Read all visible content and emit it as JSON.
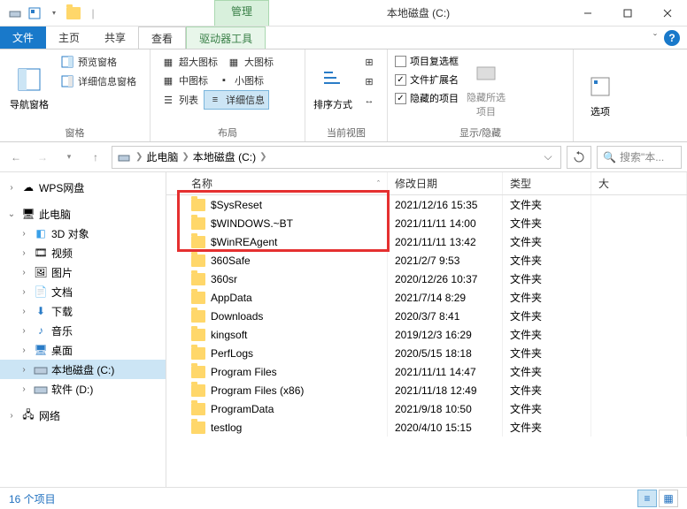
{
  "window": {
    "context_tab": "管理",
    "title": "本地磁盘 (C:)"
  },
  "menu": {
    "file": "文件",
    "home": "主页",
    "share": "共享",
    "view": "查看",
    "drive_tools": "驱动器工具"
  },
  "ribbon": {
    "nav_pane": "导航窗格",
    "preview_pane": "预览窗格",
    "details_pane": "详细信息窗格",
    "panes_label": "窗格",
    "extra_large": "超大图标",
    "large": "大图标",
    "medium": "中图标",
    "small": "小图标",
    "list": "列表",
    "details": "详细信息",
    "layout_label": "布局",
    "sort": "排序方式",
    "current_view_label": "当前视图",
    "item_checkboxes": "项目复选框",
    "file_ext": "文件扩展名",
    "hidden_items": "隐藏的项目",
    "hide_selected": "隐藏所选项目",
    "show_hide_label": "显示/隐藏",
    "options": "选项"
  },
  "address": {
    "this_pc": "此电脑",
    "drive": "本地磁盘 (C:)",
    "search_placeholder": "搜索\"本..."
  },
  "tree": {
    "wps": "WPS网盘",
    "this_pc": "此电脑",
    "threed": "3D 对象",
    "videos": "视频",
    "pictures": "图片",
    "documents": "文档",
    "downloads": "下载",
    "music": "音乐",
    "desktop": "桌面",
    "drive_c": "本地磁盘 (C:)",
    "drive_d": "软件 (D:)",
    "network": "网络"
  },
  "columns": {
    "name": "名称",
    "date": "修改日期",
    "type": "类型",
    "size": "大"
  },
  "files": [
    {
      "name": "$SysReset",
      "date": "2021/12/16 15:35",
      "type": "文件夹"
    },
    {
      "name": "$WINDOWS.~BT",
      "date": "2021/11/11 14:00",
      "type": "文件夹"
    },
    {
      "name": "$WinREAgent",
      "date": "2021/11/11 13:42",
      "type": "文件夹"
    },
    {
      "name": "360Safe",
      "date": "2021/2/7 9:53",
      "type": "文件夹"
    },
    {
      "name": "360sr",
      "date": "2020/12/26 10:37",
      "type": "文件夹"
    },
    {
      "name": "AppData",
      "date": "2021/7/14 8:29",
      "type": "文件夹"
    },
    {
      "name": "Downloads",
      "date": "2020/3/7 8:41",
      "type": "文件夹"
    },
    {
      "name": "kingsoft",
      "date": "2019/12/3 16:29",
      "type": "文件夹"
    },
    {
      "name": "PerfLogs",
      "date": "2020/5/15 18:18",
      "type": "文件夹"
    },
    {
      "name": "Program Files",
      "date": "2021/11/11 14:47",
      "type": "文件夹"
    },
    {
      "name": "Program Files (x86)",
      "date": "2021/11/18 12:49",
      "type": "文件夹"
    },
    {
      "name": "ProgramData",
      "date": "2021/9/18 10:50",
      "type": "文件夹"
    },
    {
      "name": "testlog",
      "date": "2020/4/10 15:15",
      "type": "文件夹"
    }
  ],
  "statusbar": {
    "count": "16 个项目"
  }
}
